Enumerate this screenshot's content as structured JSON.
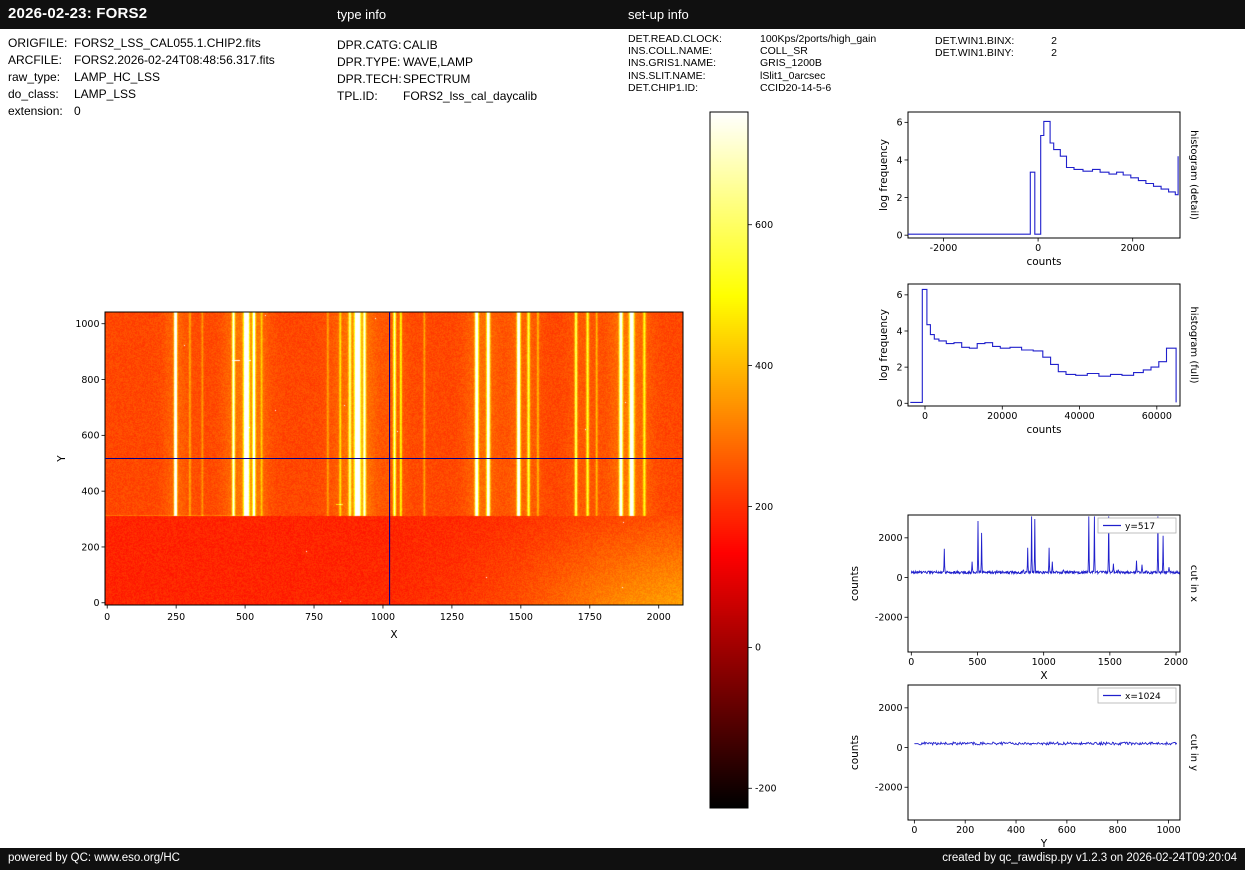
{
  "header": {
    "title": "2026-02-23: FORS2",
    "type_info_label": "type info",
    "setup_info_label": "set-up info"
  },
  "file_info": [
    {
      "label": "ORIGFILE:",
      "value": "FORS2_LSS_CAL055.1.CHIP2.fits"
    },
    {
      "label": "ARCFILE:",
      "value": "FORS2.2026-02-24T08:48:56.317.fits"
    },
    {
      "label": "raw_type:",
      "value": "LAMP_HC_LSS"
    },
    {
      "label": "do_class:",
      "value": "LAMP_LSS"
    },
    {
      "label": "extension:",
      "value": "0"
    }
  ],
  "type_info": [
    {
      "label": "DPR.CATG:",
      "value": "CALIB"
    },
    {
      "label": "DPR.TYPE:",
      "value": "WAVE,LAMP"
    },
    {
      "label": "DPR.TECH:",
      "value": "SPECTRUM"
    },
    {
      "label": "TPL.ID:",
      "value": "FORS2_lss_cal_daycalib"
    }
  ],
  "setup_info": [
    {
      "label": "DET.READ.CLOCK:",
      "value": "100Kps/2ports/high_gain"
    },
    {
      "label": "INS.COLL.NAME:",
      "value": "COLL_SR"
    },
    {
      "label": "INS.GRIS1.NAME:",
      "value": "GRIS_1200B"
    },
    {
      "label": "INS.SLIT.NAME:",
      "value": "lSlit1_0arcsec"
    },
    {
      "label": "DET.CHIP1.ID:",
      "value": "CCID20-14-5-6"
    }
  ],
  "window_info": [
    {
      "label": "DET.WIN1.BINX:",
      "value": "2"
    },
    {
      "label": "DET.WIN1.BINY:",
      "value": "2"
    }
  ],
  "footer": {
    "left": "powered by QC: www.eso.org/HC",
    "right": "created by qc_rawdisp.py v1.2.3 on 2026-02-24T09:20:04"
  },
  "chart_data": [
    {
      "id": "main_image",
      "type": "heatmap",
      "xlabel": "X",
      "ylabel": "Y",
      "xlim": [
        -8,
        2088
      ],
      "ylim": [
        -8,
        1042
      ],
      "x_ticks": [
        0,
        250,
        500,
        750,
        1000,
        1250,
        1500,
        1750,
        2000
      ],
      "y_ticks": [
        0,
        200,
        400,
        600,
        800,
        1000
      ],
      "colormap": "hot",
      "vmin": -228,
      "vmax": 760,
      "background_level": 235,
      "bottom_level": 185,
      "slit_y_start": 310,
      "crosshair": {
        "x": 1024,
        "y": 517,
        "color": "#00008b"
      },
      "glow": {
        "cx": 2110,
        "cy": -140,
        "sx": 600,
        "sy": 420,
        "amp": 190
      },
      "boundary_line": {
        "y": 310,
        "x_max": 530,
        "amp": 70
      },
      "emission_lines": [
        [
          248,
          5,
          850
        ],
        [
          300,
          4,
          130
        ],
        [
          345,
          4,
          110
        ],
        [
          458,
          5,
          520
        ],
        [
          505,
          9,
          900
        ],
        [
          532,
          5,
          620
        ],
        [
          560,
          4,
          150
        ],
        [
          800,
          4,
          120
        ],
        [
          845,
          4,
          200
        ],
        [
          880,
          5,
          360
        ],
        [
          908,
          10,
          900
        ],
        [
          933,
          5,
          520
        ],
        [
          1042,
          5,
          420
        ],
        [
          1065,
          4,
          260
        ],
        [
          1150,
          4,
          130
        ],
        [
          1340,
          6,
          720
        ],
        [
          1382,
          6,
          650
        ],
        [
          1492,
          6,
          720
        ],
        [
          1528,
          5,
          310
        ],
        [
          1562,
          4,
          150
        ],
        [
          1700,
          5,
          360
        ],
        [
          1742,
          5,
          300
        ],
        [
          1775,
          4,
          150
        ],
        [
          1863,
          6,
          720
        ],
        [
          1902,
          8,
          760
        ],
        [
          1948,
          5,
          260
        ]
      ],
      "defects": [
        {
          "y": 868,
          "x1": 452,
          "x2": 482,
          "amp": 950,
          "abs": true
        },
        {
          "y": 868,
          "x1": 497,
          "x2": 523,
          "amp": 950,
          "abs": true
        },
        {
          "y": 628,
          "x1": 497,
          "x2": 518,
          "amp": 450,
          "abs": false
        },
        {
          "y": 352,
          "x1": 828,
          "x2": 856,
          "amp": 220,
          "abs": false
        }
      ]
    },
    {
      "id": "colorbar",
      "type": "colorbar",
      "colormap": "hot",
      "vmin": -228,
      "vmax": 760,
      "ticks": [
        600,
        400,
        200,
        0,
        -200
      ]
    },
    {
      "id": "hist_detail",
      "type": "line",
      "line_style": "step",
      "line_color": "#2020cc",
      "xlabel": "counts",
      "ylabel": "log frequency",
      "side_label": "histogram (detail)",
      "xlim": [
        -2750,
        3000
      ],
      "ylim": [
        -0.15,
        6.55
      ],
      "x_ticks": [
        -2000,
        0,
        2000
      ],
      "y_ticks": [
        0,
        2,
        4,
        6
      ],
      "points": [
        [
          -2750,
          0.05
        ],
        [
          -165,
          0.05
        ],
        [
          -165,
          3.35
        ],
        [
          -70,
          3.35
        ],
        [
          -70,
          0.05
        ],
        [
          55,
          0.05
        ],
        [
          55,
          5.3
        ],
        [
          120,
          5.3
        ],
        [
          120,
          6.05
        ],
        [
          255,
          6.05
        ],
        [
          255,
          4.9
        ],
        [
          330,
          4.9
        ],
        [
          330,
          4.55
        ],
        [
          470,
          4.55
        ],
        [
          470,
          4.2
        ],
        [
          600,
          4.2
        ],
        [
          600,
          3.6
        ],
        [
          760,
          3.6
        ],
        [
          760,
          3.5
        ],
        [
          950,
          3.5
        ],
        [
          950,
          3.4
        ],
        [
          1150,
          3.4
        ],
        [
          1150,
          3.5
        ],
        [
          1310,
          3.5
        ],
        [
          1310,
          3.35
        ],
        [
          1500,
          3.35
        ],
        [
          1500,
          3.25
        ],
        [
          1660,
          3.25
        ],
        [
          1660,
          3.35
        ],
        [
          1800,
          3.35
        ],
        [
          1800,
          3.2
        ],
        [
          1960,
          3.2
        ],
        [
          1960,
          3.05
        ],
        [
          2120,
          3.05
        ],
        [
          2120,
          2.9
        ],
        [
          2280,
          2.9
        ],
        [
          2280,
          2.75
        ],
        [
          2440,
          2.75
        ],
        [
          2440,
          2.6
        ],
        [
          2600,
          2.6
        ],
        [
          2600,
          2.45
        ],
        [
          2760,
          2.45
        ],
        [
          2760,
          2.3
        ],
        [
          2900,
          2.3
        ],
        [
          2900,
          2.15
        ],
        [
          2960,
          2.15
        ],
        [
          2960,
          4.2
        ]
      ]
    },
    {
      "id": "hist_full",
      "type": "line",
      "line_style": "step",
      "line_color": "#2020cc",
      "xlabel": "counts",
      "ylabel": "log frequency",
      "side_label": "histogram (full)",
      "xlim": [
        -4400,
        66000
      ],
      "ylim": [
        -0.15,
        6.6
      ],
      "x_ticks": [
        0,
        20000,
        40000,
        60000
      ],
      "y_ticks": [
        0,
        2,
        4,
        6
      ],
      "points": [
        [
          -3800,
          0.05
        ],
        [
          -700,
          0.05
        ],
        [
          -700,
          6.3
        ],
        [
          500,
          6.3
        ],
        [
          500,
          4.35
        ],
        [
          1400,
          4.35
        ],
        [
          1400,
          3.8
        ],
        [
          2400,
          3.8
        ],
        [
          2400,
          3.55
        ],
        [
          3600,
          3.55
        ],
        [
          3600,
          3.45
        ],
        [
          5500,
          3.45
        ],
        [
          5500,
          3.3
        ],
        [
          7500,
          3.3
        ],
        [
          7500,
          3.35
        ],
        [
          9500,
          3.35
        ],
        [
          9500,
          3.1
        ],
        [
          11500,
          3.1
        ],
        [
          11500,
          3.05
        ],
        [
          13500,
          3.05
        ],
        [
          13500,
          3.3
        ],
        [
          15500,
          3.3
        ],
        [
          15500,
          3.35
        ],
        [
          17500,
          3.35
        ],
        [
          17500,
          3.15
        ],
        [
          19500,
          3.15
        ],
        [
          19500,
          3.05
        ],
        [
          22000,
          3.05
        ],
        [
          22000,
          3.1
        ],
        [
          25000,
          3.1
        ],
        [
          25000,
          2.95
        ],
        [
          28000,
          2.95
        ],
        [
          28000,
          2.9
        ],
        [
          30500,
          2.9
        ],
        [
          30500,
          2.55
        ],
        [
          32500,
          2.55
        ],
        [
          32500,
          2.15
        ],
        [
          34500,
          2.15
        ],
        [
          34500,
          1.75
        ],
        [
          36500,
          1.75
        ],
        [
          36500,
          1.6
        ],
        [
          39000,
          1.6
        ],
        [
          39000,
          1.55
        ],
        [
          42000,
          1.55
        ],
        [
          42000,
          1.65
        ],
        [
          45000,
          1.65
        ],
        [
          45000,
          1.5
        ],
        [
          48000,
          1.5
        ],
        [
          48000,
          1.6
        ],
        [
          51000,
          1.6
        ],
        [
          51000,
          1.55
        ],
        [
          54000,
          1.55
        ],
        [
          54000,
          1.7
        ],
        [
          56500,
          1.7
        ],
        [
          56500,
          1.85
        ],
        [
          58500,
          1.85
        ],
        [
          58500,
          2.0
        ],
        [
          60500,
          2.0
        ],
        [
          60500,
          2.3
        ],
        [
          62500,
          2.3
        ],
        [
          62500,
          3.05
        ],
        [
          65000,
          3.05
        ],
        [
          65000,
          0.05
        ]
      ]
    },
    {
      "id": "cut_x",
      "type": "line",
      "line_color": "#2020cc",
      "xlabel": "X",
      "ylabel": "counts",
      "side_label": "cut in x",
      "legend": "y=517",
      "xlim": [
        -25,
        2030
      ],
      "ylim": [
        -3750,
        3150
      ],
      "x_ticks": [
        0,
        500,
        1000,
        1500,
        2000
      ],
      "y_ticks": [
        -2000,
        0,
        2000
      ],
      "xdata": [
        0,
        2028
      ],
      "baseline": 260,
      "noise": 130,
      "spikes": [
        [
          250,
          1450
        ],
        [
          458,
          800
        ],
        [
          505,
          2850
        ],
        [
          532,
          2250
        ],
        [
          845,
          380
        ],
        [
          880,
          1500
        ],
        [
          908,
          3080
        ],
        [
          933,
          2950
        ],
        [
          1042,
          1500
        ],
        [
          1065,
          800
        ],
        [
          1150,
          380
        ],
        [
          1340,
          3080
        ],
        [
          1382,
          3080
        ],
        [
          1492,
          3080
        ],
        [
          1528,
          700
        ],
        [
          1562,
          380
        ],
        [
          1700,
          850
        ],
        [
          1742,
          650
        ],
        [
          1775,
          330
        ],
        [
          1863,
          3080
        ],
        [
          1902,
          2100
        ],
        [
          1948,
          520
        ]
      ]
    },
    {
      "id": "cut_y",
      "type": "line",
      "line_color": "#2020cc",
      "xlabel": "Y",
      "ylabel": "counts",
      "side_label": "cut in y",
      "legend": "x=1024",
      "xlim": [
        -25,
        1045
      ],
      "ylim": [
        -3650,
        3150
      ],
      "x_ticks": [
        0,
        200,
        400,
        600,
        800,
        1000
      ],
      "y_ticks": [
        -2000,
        0,
        2000
      ],
      "xdata": [
        0,
        1034
      ],
      "baseline": 205,
      "noise": 140,
      "spikes": []
    }
  ]
}
